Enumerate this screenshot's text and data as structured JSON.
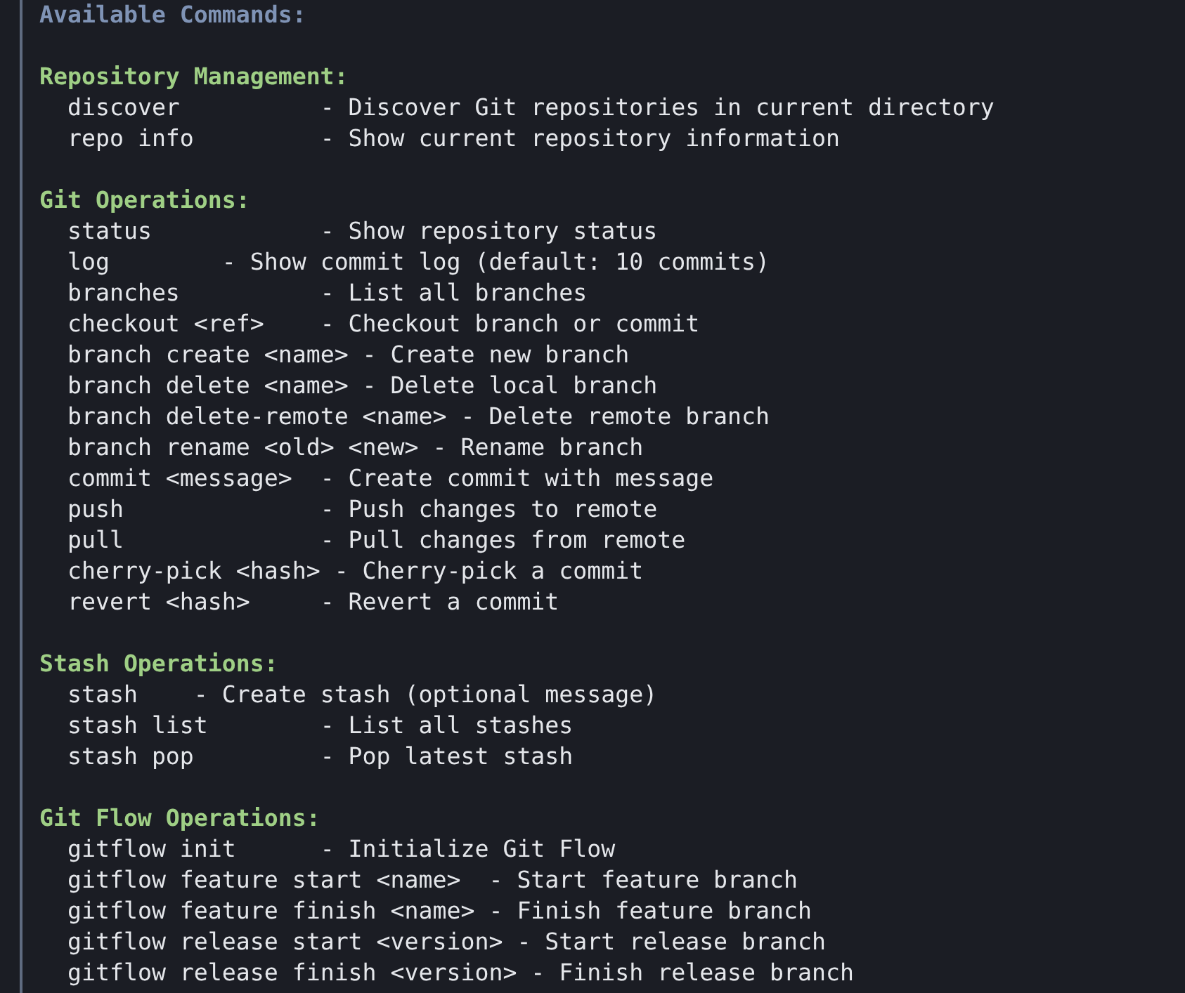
{
  "heading": "Available Commands:",
  "sections": [
    {
      "title": "Repository Management:",
      "lines": [
        "discover          - Discover Git repositories in current directory",
        "repo info         - Show current repository information"
      ]
    },
    {
      "title": "Git Operations:",
      "lines": [
        "status            - Show repository status",
        "log        - Show commit log (default: 10 commits)",
        "branches          - List all branches",
        "checkout <ref>    - Checkout branch or commit",
        "branch create <name> - Create new branch",
        "branch delete <name> - Delete local branch",
        "branch delete-remote <name> - Delete remote branch",
        "branch rename <old> <new> - Rename branch",
        "commit <message>  - Create commit with message",
        "push              - Push changes to remote",
        "pull              - Pull changes from remote",
        "cherry-pick <hash> - Cherry-pick a commit",
        "revert <hash>     - Revert a commit"
      ]
    },
    {
      "title": "Stash Operations:",
      "lines": [
        "stash    - Create stash (optional message)",
        "stash list        - List all stashes",
        "stash pop         - Pop latest stash"
      ]
    },
    {
      "title": "Git Flow Operations:",
      "lines": [
        "gitflow init      - Initialize Git Flow",
        "gitflow feature start <name>  - Start feature branch",
        "gitflow feature finish <name> - Finish feature branch",
        "gitflow release start <version> - Start release branch",
        "gitflow release finish <version> - Finish release branch"
      ]
    }
  ]
}
